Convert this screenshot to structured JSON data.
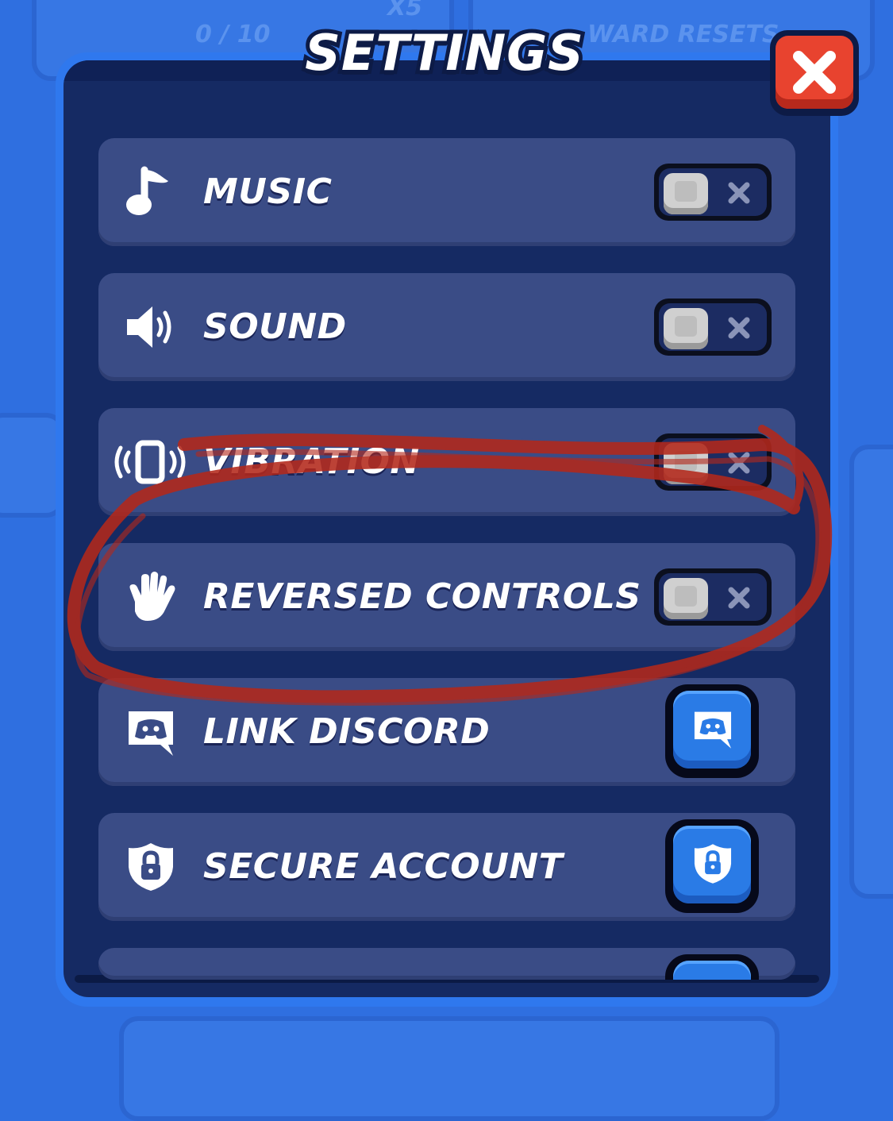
{
  "background": {
    "counter_text": "0 / 10",
    "multiplier_text": "X5",
    "reset_text": "WARD RESETS"
  },
  "dialog": {
    "title": "SETTINGS",
    "close_icon": "close-x-icon"
  },
  "settings": [
    {
      "label": "MUSIC",
      "icon": "music-note-icon",
      "control": "toggle",
      "state": "off"
    },
    {
      "label": "SOUND",
      "icon": "speaker-icon",
      "control": "toggle",
      "state": "off"
    },
    {
      "label": "VIBRATION",
      "icon": "vibration-icon",
      "control": "toggle",
      "state": "off"
    },
    {
      "label": "REVERSED CONTROLS",
      "icon": "hand-icon",
      "control": "toggle",
      "state": "off"
    },
    {
      "label": "LINK DISCORD",
      "icon": "discord-icon",
      "control": "button",
      "button_icon": "discord-icon"
    },
    {
      "label": "SECURE ACCOUNT",
      "icon": "shield-lock-icon",
      "control": "button",
      "button_icon": "shield-lock-icon"
    }
  ],
  "colors": {
    "panel": "#152a63",
    "row": "#3a4c86",
    "close_button": "#e8432f",
    "action_button": "#2a7be6",
    "annotation": "#b3281b"
  }
}
